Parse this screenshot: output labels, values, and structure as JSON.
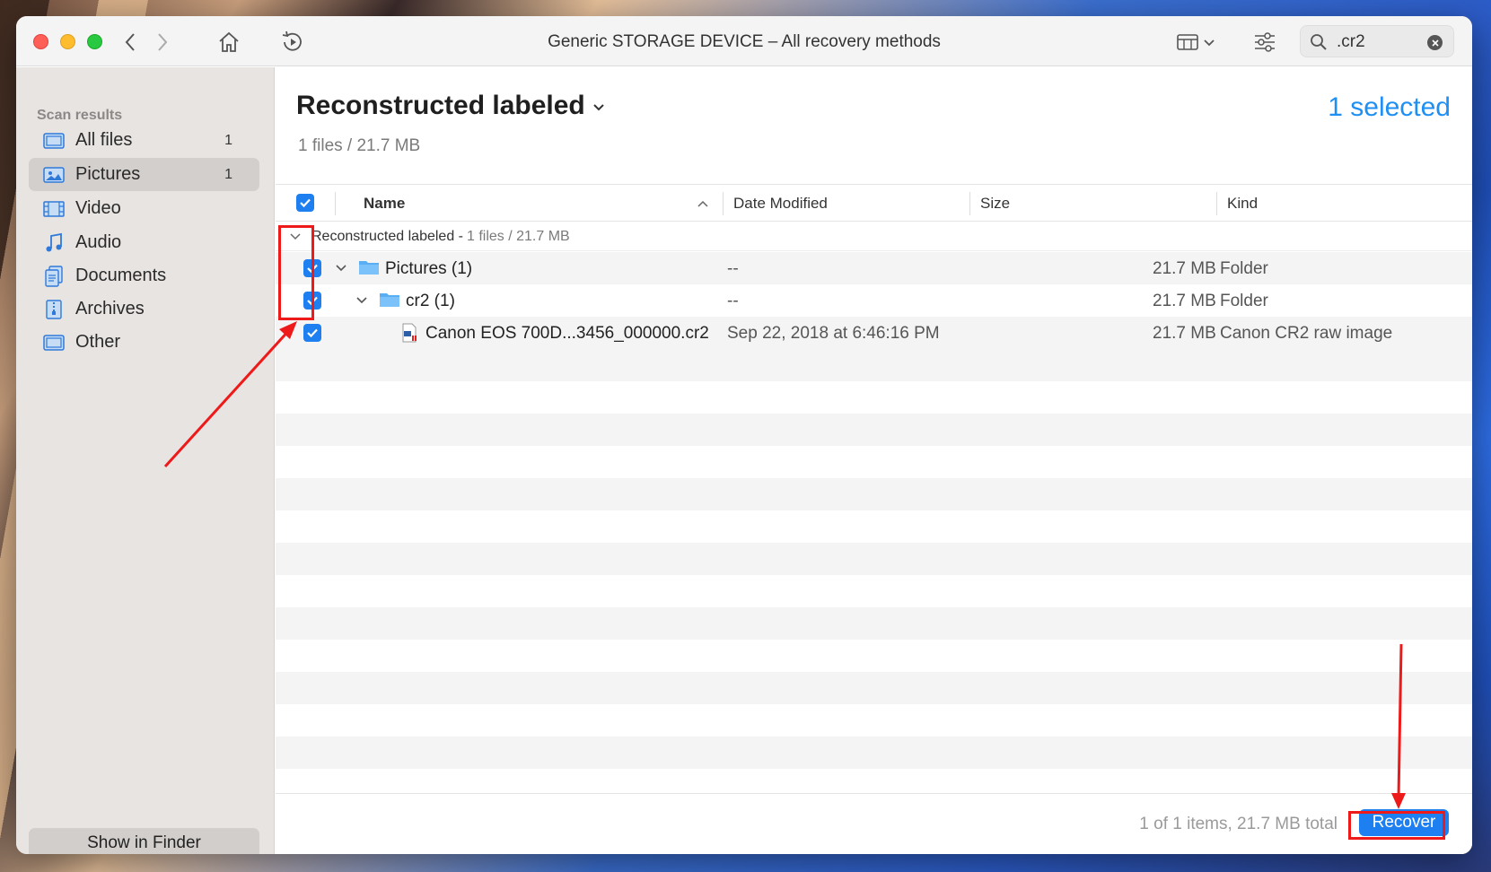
{
  "window": {
    "title": "Generic STORAGE DEVICE – All recovery methods"
  },
  "search": {
    "value": ".cr2",
    "placeholder": "Search"
  },
  "sidebar": {
    "heading": "Scan results",
    "items": [
      {
        "label": "All files",
        "count": "1",
        "icon": "all-files-icon",
        "active": false
      },
      {
        "label": "Pictures",
        "count": "1",
        "icon": "pictures-icon",
        "active": true
      },
      {
        "label": "Video",
        "count": "",
        "icon": "video-icon",
        "active": false
      },
      {
        "label": "Audio",
        "count": "",
        "icon": "audio-icon",
        "active": false
      },
      {
        "label": "Documents",
        "count": "",
        "icon": "documents-icon",
        "active": false
      },
      {
        "label": "Archives",
        "count": "",
        "icon": "archives-icon",
        "active": false
      },
      {
        "label": "Other",
        "count": "",
        "icon": "other-icon",
        "active": false
      }
    ],
    "finder_button": "Show in Finder"
  },
  "main": {
    "title": "Reconstructed labeled",
    "subtitle": "1 files / 21.7 MB",
    "selected": "1 selected"
  },
  "table": {
    "columns": {
      "name": "Name",
      "date": "Date Modified",
      "size": "Size",
      "kind": "Kind"
    },
    "group": {
      "label": "Reconstructed labeled -",
      "meta": "1 files / 21.7 MB"
    },
    "rows": [
      {
        "name": "Pictures (1)",
        "date": "--",
        "size": "21.7 MB",
        "kind": "Folder"
      },
      {
        "name": "cr2 (1)",
        "date": "--",
        "size": "21.7 MB",
        "kind": "Folder"
      },
      {
        "name": "Canon EOS 700D...3456_000000.cr2",
        "date": "Sep 22, 2018 at 6:46:16 PM",
        "size": "21.7 MB",
        "kind": "Canon CR2 raw image"
      }
    ]
  },
  "footer": {
    "status": "1 of 1 items, 21.7 MB total",
    "recover": "Recover"
  },
  "colors": {
    "accent": "#1e7ff0",
    "annotation": "#ee1a1a"
  }
}
